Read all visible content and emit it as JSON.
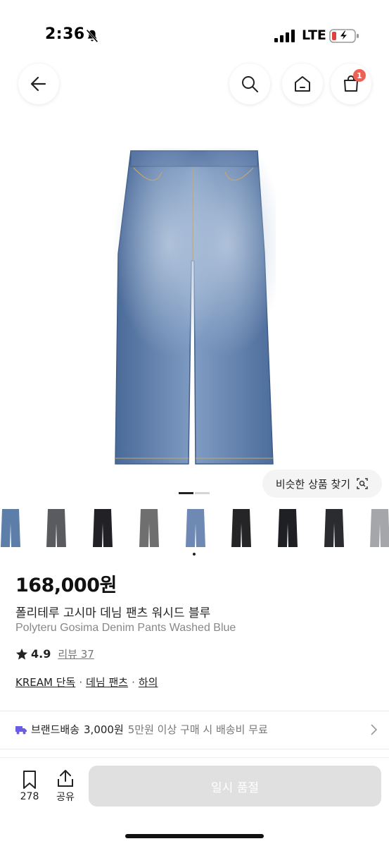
{
  "status": {
    "time": "2:36",
    "network": "LTE"
  },
  "header": {
    "cart_count": "1"
  },
  "similar_button": {
    "label": "비슷한 상품 찾기"
  },
  "gallery": {
    "page_count": 2,
    "active_page": 1
  },
  "swatches": {
    "colors": [
      "#5d7ea8",
      "#5a5b5e",
      "#222226",
      "#6f6f70",
      "#6f89b5",
      "#252528",
      "#1f2024",
      "#2b2c30",
      "#a4a6aa"
    ]
  },
  "product": {
    "price": "168,000원",
    "name_ko": "폴리테루 고시마 데님 팬츠 워시드 블루",
    "name_en": "Polyteru Gosima Denim Pants Washed Blue",
    "rating": "4.9",
    "review_label": "리뷰 37",
    "tags": [
      "KREAM 단독",
      "데님 팬츠",
      "하의"
    ],
    "tag_separator": "·"
  },
  "shipping": {
    "title": "브랜드배송",
    "price": "3,000원",
    "description": "5만원 이상 구매 시 배송비 무료"
  },
  "bottom": {
    "save_count": "278",
    "share_label": "공유",
    "soldout_label": "일시 품절"
  },
  "colors": {
    "accent_badge": "#ef6253",
    "shipping_icon": "#6b5ce7",
    "denim": "#5b7aa8"
  }
}
